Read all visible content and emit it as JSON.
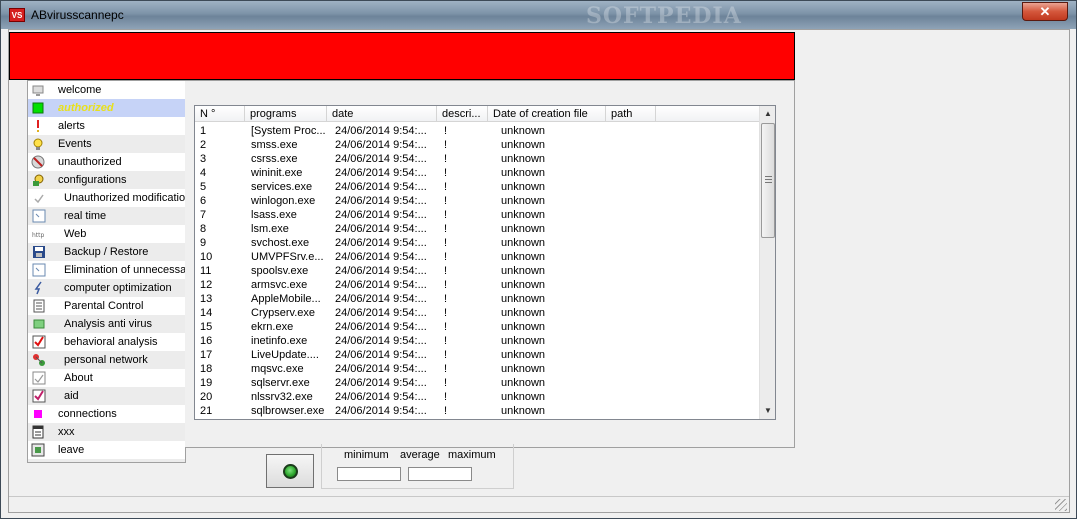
{
  "window": {
    "title": "ABvirusscannepc",
    "app_icon_text": "VS",
    "watermark": "SOFTPEDIA",
    "close_symbol": "✕"
  },
  "sidebar": {
    "items": [
      {
        "label": "welcome",
        "icon": "computer-icon",
        "level": 0
      },
      {
        "label": "authorized",
        "icon": "green-square-icon",
        "level": 0,
        "selected": true
      },
      {
        "label": "alerts",
        "icon": "warning-icon",
        "level": 0
      },
      {
        "label": "Events",
        "icon": "lightbulb-icon",
        "level": 0
      },
      {
        "label": "unauthorized",
        "icon": "block-icon",
        "level": 0
      },
      {
        "label": "configurations",
        "icon": "config-gear-icon",
        "level": 0
      },
      {
        "label": "Unauthorized modification",
        "icon": "check-mark-icon",
        "level": 1
      },
      {
        "label": "real time",
        "icon": "clock-box-icon",
        "level": 1
      },
      {
        "label": "Web",
        "icon": "http-icon",
        "level": 1
      },
      {
        "label": "Backup / Restore",
        "icon": "floppy-icon",
        "level": 1
      },
      {
        "label": "Elimination of unnecessary",
        "icon": "trash-box-icon",
        "level": 1
      },
      {
        "label": "computer optimization",
        "icon": "speed-icon",
        "level": 1
      },
      {
        "label": "Parental Control",
        "icon": "list-icon",
        "level": 1
      },
      {
        "label": "Analysis anti virus",
        "icon": "green-rect-icon",
        "level": 1
      },
      {
        "label": "behavioral analysis",
        "icon": "red-check-icon",
        "level": 1
      },
      {
        "label": "personal network",
        "icon": "network-icon",
        "level": 1
      },
      {
        "label": "About",
        "icon": "check-box-icon",
        "level": 1
      },
      {
        "label": "aid",
        "icon": "pink-check-icon",
        "level": 1
      },
      {
        "label": "connections",
        "icon": "magenta-square-icon",
        "level": 0
      },
      {
        "label": "xxx",
        "icon": "notes-icon",
        "level": 0
      },
      {
        "label": "leave",
        "icon": "exit-icon",
        "level": 0
      }
    ]
  },
  "table": {
    "columns": [
      "N °",
      "programs",
      "date",
      "descri...",
      "Date of creation file",
      "path"
    ],
    "rows": [
      [
        "1",
        "[System Proc...",
        "24/06/2014 9:54:...",
        "!",
        "unknown"
      ],
      [
        "2",
        "smss.exe",
        "24/06/2014 9:54:...",
        "!",
        "unknown"
      ],
      [
        "3",
        "csrss.exe",
        "24/06/2014 9:54:...",
        "!",
        "unknown"
      ],
      [
        "4",
        "wininit.exe",
        "24/06/2014 9:54:...",
        "!",
        "unknown"
      ],
      [
        "5",
        "services.exe",
        "24/06/2014 9:54:...",
        "!",
        "unknown"
      ],
      [
        "6",
        "winlogon.exe",
        "24/06/2014 9:54:...",
        "!",
        "unknown"
      ],
      [
        "7",
        "lsass.exe",
        "24/06/2014 9:54:...",
        "!",
        "unknown"
      ],
      [
        "8",
        "lsm.exe",
        "24/06/2014 9:54:...",
        "!",
        "unknown"
      ],
      [
        "9",
        "svchost.exe",
        "24/06/2014 9:54:...",
        "!",
        "unknown"
      ],
      [
        "10",
        "UMVPFSrv.e...",
        "24/06/2014 9:54:...",
        "!",
        "unknown"
      ],
      [
        "11",
        "spoolsv.exe",
        "24/06/2014 9:54:...",
        "!",
        "unknown"
      ],
      [
        "12",
        "armsvc.exe",
        "24/06/2014 9:54:...",
        "!",
        "unknown"
      ],
      [
        "13",
        "AppleMobile...",
        "24/06/2014 9:54:...",
        "!",
        "unknown"
      ],
      [
        "14",
        "Crypserv.exe",
        "24/06/2014 9:54:...",
        "!",
        "unknown"
      ],
      [
        "15",
        "ekrn.exe",
        "24/06/2014 9:54:...",
        "!",
        "unknown"
      ],
      [
        "16",
        "inetinfo.exe",
        "24/06/2014 9:54:...",
        "!",
        "unknown"
      ],
      [
        "17",
        "LiveUpdate....",
        "24/06/2014 9:54:...",
        "!",
        "unknown"
      ],
      [
        "18",
        "mqsvc.exe",
        "24/06/2014 9:54:...",
        "!",
        "unknown"
      ],
      [
        "19",
        "sqlservr.exe",
        "24/06/2014 9:54:...",
        "!",
        "unknown"
      ],
      [
        "20",
        "nlssrv32.exe",
        "24/06/2014 9:54:...",
        "!",
        "unknown"
      ],
      [
        "21",
        "sqlbrowser.exe",
        "24/06/2014 9:54:...",
        "!",
        "unknown"
      ]
    ],
    "scroll_up": "▲",
    "scroll_down": "▼"
  },
  "stats": {
    "minimum_label": "minimum",
    "average_label": "average",
    "maximum_label": "maximum",
    "minimum_value": "",
    "average_value": ""
  },
  "colors": {
    "banner": "#ff0000",
    "selected_row": "#c6d3f7",
    "selected_text": "#e8e01c"
  }
}
